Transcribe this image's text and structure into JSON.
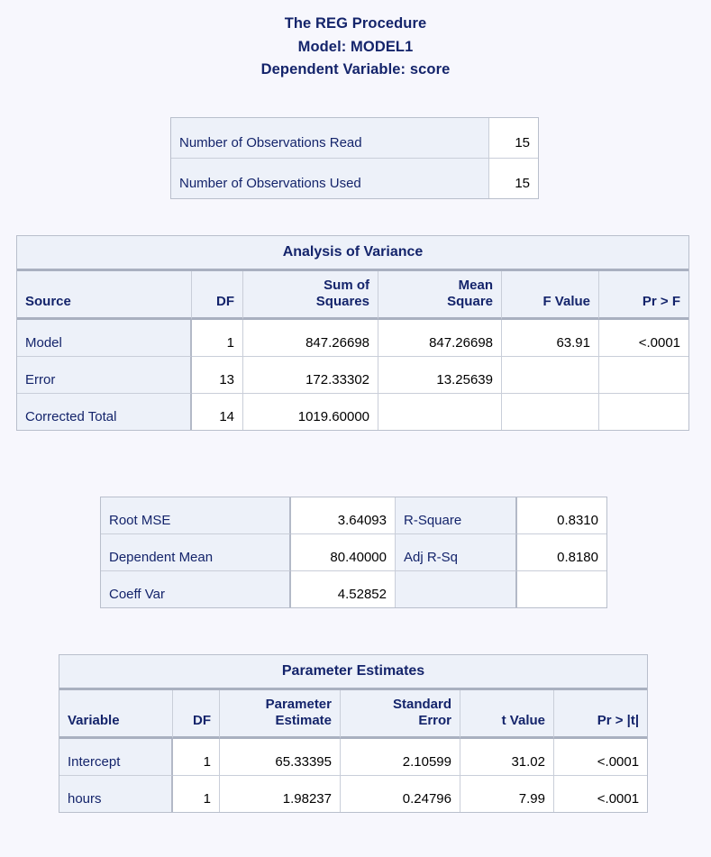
{
  "title": {
    "line1": "The REG Procedure",
    "line2": "Model: MODEL1",
    "line3": "Dependent Variable: score"
  },
  "observations": {
    "rows": [
      {
        "label": "Number of Observations Read",
        "value": "15"
      },
      {
        "label": "Number of Observations Used",
        "value": "15"
      }
    ]
  },
  "anova": {
    "caption": "Analysis of Variance",
    "headers": [
      "Source",
      "DF",
      "Sum of Squares",
      "Mean Square",
      "F Value",
      "Pr > F"
    ],
    "header_lines": [
      [
        "Source"
      ],
      [
        "DF"
      ],
      [
        "Sum of",
        "Squares"
      ],
      [
        "Mean",
        "Square"
      ],
      [
        "F Value"
      ],
      [
        "Pr > F"
      ]
    ],
    "rows": [
      {
        "source": "Model",
        "df": "1",
        "ss": "847.26698",
        "ms": "847.26698",
        "f": "63.91",
        "p": "<.0001"
      },
      {
        "source": "Error",
        "df": "13",
        "ss": "172.33302",
        "ms": "13.25639",
        "f": "",
        "p": ""
      },
      {
        "source": "Corrected Total",
        "df": "14",
        "ss": "1019.60000",
        "ms": "",
        "f": "",
        "p": ""
      }
    ]
  },
  "fit_statistics": {
    "rows": [
      {
        "label1": "Root MSE",
        "value1": "3.64093",
        "label2": "R-Square",
        "value2": "0.8310"
      },
      {
        "label1": "Dependent Mean",
        "value1": "80.40000",
        "label2": "Adj R-Sq",
        "value2": "0.8180"
      },
      {
        "label1": "Coeff Var",
        "value1": "4.52852",
        "label2": "",
        "value2": ""
      }
    ]
  },
  "parameter_estimates": {
    "caption": "Parameter Estimates",
    "headers": [
      "Variable",
      "DF",
      "Parameter Estimate",
      "Standard Error",
      "t Value",
      "Pr > |t|"
    ],
    "header_lines": [
      [
        "Variable"
      ],
      [
        "DF"
      ],
      [
        "Parameter",
        "Estimate"
      ],
      [
        "Standard",
        "Error"
      ],
      [
        "t Value"
      ],
      [
        "Pr > |t|"
      ]
    ],
    "rows": [
      {
        "variable": "Intercept",
        "df": "1",
        "estimate": "65.33395",
        "stderr": "2.10599",
        "t": "31.02",
        "p": "<.0001"
      },
      {
        "variable": "hours",
        "df": "1",
        "estimate": "1.98237",
        "stderr": "0.24796",
        "t": "7.99",
        "p": "<.0001"
      }
    ]
  },
  "colors": {
    "page_background": "#f7f7fd",
    "header_fill": "#edf1f9",
    "label_text": "#14246b",
    "value_text": "#000000",
    "cell_border": "#c9ced9",
    "heavy_border": "#a9b0c0"
  }
}
